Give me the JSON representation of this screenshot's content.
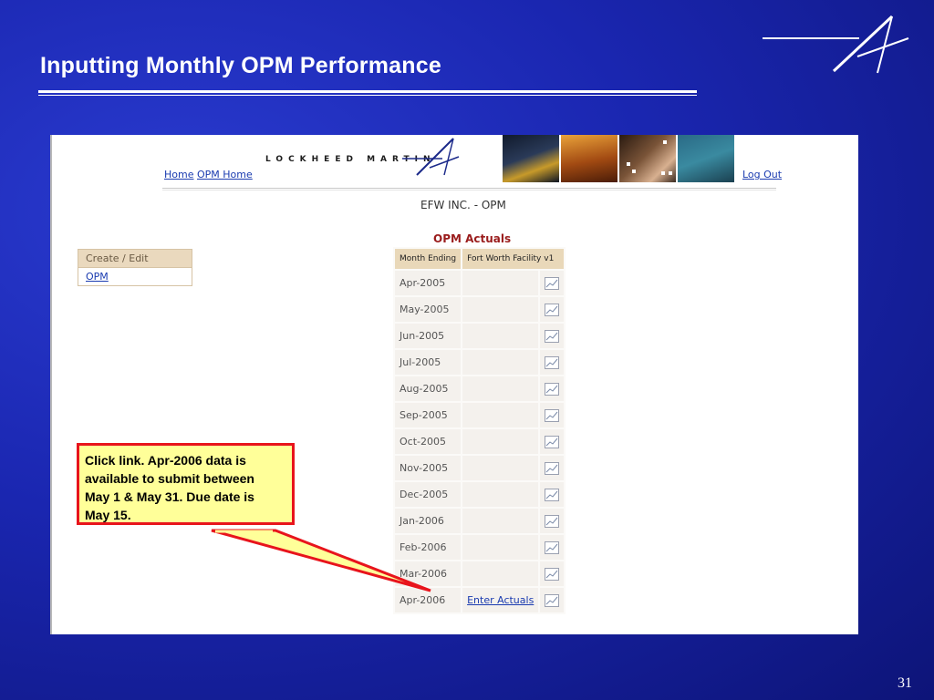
{
  "slide": {
    "title": "Inputting Monthly OPM Performance",
    "page_number": "31"
  },
  "app": {
    "brand_wordmark": "LOCKHEED MARTIN",
    "nav": {
      "home": "Home",
      "opm_home": "OPM Home",
      "logout": "Log Out"
    },
    "company_title": "EFW INC. - OPM",
    "section_title": "OPM Actuals",
    "sidebar": {
      "header": "Create / Edit",
      "items": [
        "OPM"
      ]
    },
    "table": {
      "headers": [
        "Month Ending",
        "Fort Worth Facility v1"
      ],
      "rows": [
        {
          "month": "Apr-2005",
          "link": ""
        },
        {
          "month": "May-2005",
          "link": ""
        },
        {
          "month": "Jun-2005",
          "link": ""
        },
        {
          "month": "Jul-2005",
          "link": ""
        },
        {
          "month": "Aug-2005",
          "link": ""
        },
        {
          "month": "Sep-2005",
          "link": ""
        },
        {
          "month": "Oct-2005",
          "link": ""
        },
        {
          "month": "Nov-2005",
          "link": ""
        },
        {
          "month": "Dec-2005",
          "link": ""
        },
        {
          "month": "Jan-2006",
          "link": ""
        },
        {
          "month": "Feb-2006",
          "link": ""
        },
        {
          "month": "Mar-2006",
          "link": ""
        },
        {
          "month": "Apr-2006",
          "link": "Enter Actuals"
        }
      ]
    }
  },
  "callout": {
    "lines": [
      "Click link.  Apr-2006 data is",
      "available to submit between",
      "May 1 & May 31.  Due date is",
      "May 15."
    ]
  },
  "colors": {
    "background": "#1a26b0",
    "link": "#1a3bb0",
    "section_title": "#9a1c1c",
    "callout_border": "#e8141c",
    "callout_fill": "#ffff99"
  }
}
